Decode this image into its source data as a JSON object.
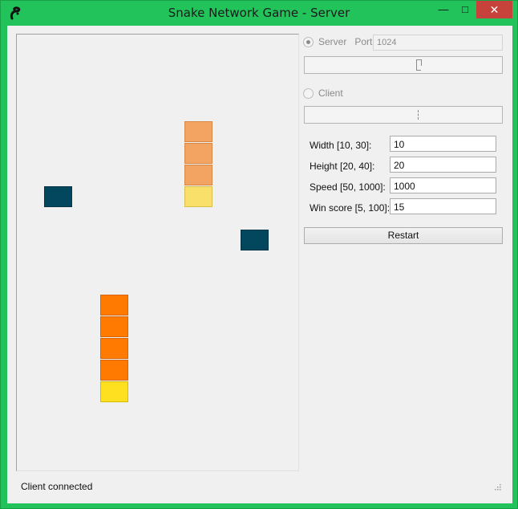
{
  "window": {
    "title": "Snake Network Game - Server",
    "frame_color": "#22c35a",
    "close_color": "#c7423b"
  },
  "icons": {
    "app": "snake-app-icon",
    "minimize": "minimize-icon",
    "maximize": "maximize-icon",
    "close": "close-icon",
    "resize": "resize-grip-icon"
  },
  "caption": {
    "minimize": "—",
    "maximize": "□",
    "close": "✕"
  },
  "network": {
    "server_label": "Server",
    "server_selected": true,
    "port_label": "Port",
    "port_value": "1024",
    "client_label": "Client",
    "client_selected": false
  },
  "settings": [
    {
      "label": "Width [10, 30]:",
      "value": "10"
    },
    {
      "label": "Height [20, 40]:",
      "value": "20"
    },
    {
      "label": "Speed [50, 1000]:",
      "value": "1000"
    },
    {
      "label": "Win score [5, 100]:",
      "value": "15"
    }
  ],
  "restart_label": "Restart",
  "status_text": "Client connected",
  "colors": {
    "food": "#02475e",
    "snake1_body": "#f4a462",
    "snake1_head": "#f8e06a",
    "snake2_body": "#ff7a00",
    "snake2_head": "#ffe020"
  }
}
